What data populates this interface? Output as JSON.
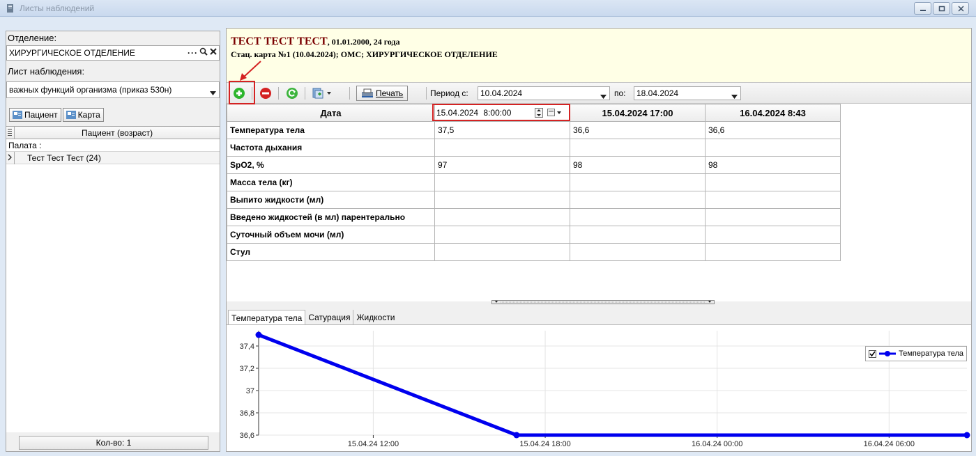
{
  "window": {
    "title": "Листы наблюдений"
  },
  "left": {
    "department_label": "Отделение:",
    "department_value": "ХИРУРГИЧЕСКОЕ ОТДЕЛЕНИЕ",
    "sheet_label": "Лист наблюдения:",
    "sheet_value": "важных функций организма (приказ 530н)",
    "btn_patient": "Пациент",
    "btn_card": "Карта",
    "grid_header": "Пациент (возраст)",
    "group_label": "Палата :",
    "patient_row": "Тест Тест Тест (24)",
    "footer": "Кол-во: 1"
  },
  "patient": {
    "name": "ТЕСТ ТЕСТ ТЕСТ",
    "details": ", 01.01.2000, 24 года",
    "card": "Стац. карта №1 (10.04.2024); ОМС; ХИРУРГИЧЕСКОЕ ОТДЕЛЕНИЕ"
  },
  "toolbar": {
    "print": "Печать",
    "period_from_label": "Период с:",
    "period_from": "10.04.2024",
    "period_to_label": "по:",
    "period_to": "18.04.2024"
  },
  "table": {
    "date_header": "Дата",
    "col1_date": "15.04.2024",
    "col1_time": "8:00:00",
    "col2": "15.04.2024 17:00",
    "col3": "16.04.2024 8:43",
    "rows": [
      {
        "label": "Температура тела",
        "v1": "37,5",
        "v2": "36,6",
        "v3": "36,6"
      },
      {
        "label": "Частота дыхания",
        "v1": "",
        "v2": "",
        "v3": ""
      },
      {
        "label": "SpO2, %",
        "v1": "97",
        "v2": "98",
        "v3": "98"
      },
      {
        "label": "Масса тела (кг)",
        "v1": "",
        "v2": "",
        "v3": ""
      },
      {
        "label": "Выпито жидкости (мл)",
        "v1": "",
        "v2": "",
        "v3": ""
      },
      {
        "label": "Введено жидкостей (в мл) парентерально",
        "v1": "",
        "v2": "",
        "v3": ""
      },
      {
        "label": "Суточный объем мочи (мл)",
        "v1": "",
        "v2": "",
        "v3": ""
      },
      {
        "label": "Стул",
        "v1": "",
        "v2": "",
        "v3": ""
      }
    ]
  },
  "tabs": [
    "Температура тела",
    "Сатурация",
    "Жидкости"
  ],
  "chart_data": {
    "type": "line",
    "series": [
      {
        "name": "Температура тела",
        "x": [
          "15.04.24 08:00",
          "15.04.24 17:00",
          "16.04.24 08:43"
        ],
        "values": [
          37.5,
          36.6,
          36.6
        ]
      }
    ],
    "y_ticks": [
      "37,4",
      "37,2",
      "37",
      "36,8",
      "36,6"
    ],
    "x_ticks": [
      "15.04.24 12:00",
      "15.04.24 18:00",
      "16.04.24 00:00",
      "16.04.24 06:00"
    ],
    "ylim": [
      36.6,
      37.5
    ],
    "grid": true,
    "legend": "top-right",
    "color": "#0000ee"
  }
}
